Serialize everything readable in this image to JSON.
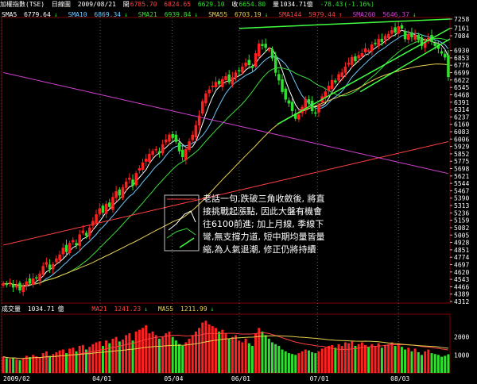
{
  "header": {
    "name": "加權指數(TSE)",
    "period": "日線圖",
    "date": "2009/08/21",
    "open_label": "開",
    "open": "6785.70",
    "high": "6824.65",
    "low": "6629.10",
    "close_label": "收",
    "close": "6654.80",
    "vol_label": "量",
    "volume": "1034.71",
    "vol_unit": "億",
    "change": "-78.43",
    "change_pct": "(-1.16%)"
  },
  "ma_legend": [
    {
      "label": "SMA5",
      "value": "6779.64",
      "arrow": "↓",
      "color": "#ffffff"
    },
    {
      "label": "SMA10",
      "value": "6869.34",
      "arrow": "↓",
      "color": "#6ec8ff"
    },
    {
      "label": "SMA21",
      "value": "6939.84",
      "arrow": "↓",
      "color": "#3cdc3c"
    },
    {
      "label": "SMA55",
      "value": "6703.19",
      "arrow": "↓",
      "color": "#e8d050"
    },
    {
      "label": "SMA144",
      "value": "5979.44",
      "arrow": "↑",
      "color": "#ff4040"
    },
    {
      "label": "SMA260",
      "value": "5646.37",
      "arrow": "↓",
      "color": "#d040d0"
    }
  ],
  "vol_legend": [
    {
      "label": "成交量",
      "value": "1034.71",
      "unit": "億",
      "color": "#ffffff"
    },
    {
      "label": "MA21",
      "value": "1241.23",
      "arrow": "↓",
      "color": "#ff4040"
    },
    {
      "label": "MA55",
      "value": "1211.99",
      "arrow": "↓",
      "color": "#e8d050"
    }
  ],
  "annotation": "老話一句,跌破三角收斂後, 將直接挑戰起漲點, 因此大盤有機會往6100前進; 加上月線, 季線下彎,無支撐力道, 短中期均量皆量縮,為人氣退潮, 修正仍將持續",
  "colors": {
    "up": "#ff2020",
    "down": "#30e030",
    "bg": "#000000",
    "axis": "#800000",
    "trend": "#40ff40"
  },
  "chart_data": [
    {
      "type": "candlestick",
      "title": "加權指數(TSE) 日線圖",
      "ylim": [
        4312,
        7258
      ],
      "y_ticks": [
        7258,
        7161,
        7084,
        6930,
        6853,
        6776,
        6699,
        6622,
        6545,
        6468,
        6391,
        6314,
        6237,
        6160,
        6083,
        6006,
        5929,
        5852,
        5775,
        5698,
        5621,
        5544,
        5467,
        5390,
        5313,
        5236,
        5159,
        5082,
        5005,
        4928,
        4851,
        4774,
        4697,
        4620,
        4543,
        4466,
        4389,
        4312
      ],
      "x_ticks": [
        "2009/02",
        "04/01",
        "05/04",
        "06/01",
        "07/01",
        "08/03"
      ],
      "close_series": [
        4500,
        4490,
        4510,
        4460,
        4480,
        4430,
        4470,
        4520,
        4500,
        4550,
        4560,
        4600,
        4680,
        4720,
        4650,
        4700,
        4760,
        4800,
        4870,
        4830,
        4920,
        4950,
        4900,
        5010,
        5050,
        5000,
        5080,
        5150,
        5220,
        5280,
        5240,
        5330,
        5300,
        5400,
        5460,
        5420,
        5500,
        5560,
        5600,
        5520,
        5650,
        5700,
        5760,
        5800,
        5850,
        5880,
        5900,
        5860,
        5950,
        6000,
        6050,
        6020,
        5980,
        5880,
        5820,
        5900,
        5980,
        6050,
        6150,
        6250,
        6400,
        6480,
        6520,
        6560,
        6600,
        6580,
        6630,
        6660,
        6600,
        6650,
        6700,
        6720,
        6760,
        6800,
        6780,
        6750,
        6900,
        7000,
        6980,
        6960,
        6940,
        6850,
        6700,
        6620,
        6500,
        6420,
        6380,
        6300,
        6220,
        6260,
        6340,
        6420,
        6380,
        6300,
        6280,
        6360,
        6450,
        6500,
        6560,
        6620,
        6600,
        6680,
        6700,
        6760,
        6800,
        6860,
        6820,
        6880,
        6900,
        6950,
        6930,
        6990,
        7000,
        7050,
        7020,
        7080,
        7100,
        7140,
        7120,
        7180,
        7160,
        7050,
        7100,
        7070,
        7090,
        7040,
        6980,
        7020,
        7060,
        7020,
        6980,
        6950,
        6900,
        6860,
        6654.8
      ],
      "trendlines": [
        {
          "from": [
            "06/01",
            7161
          ],
          "to": [
            "08/21",
            7258
          ]
        },
        {
          "from": [
            "06/15",
            6160
          ],
          "to": [
            "08/21",
            7161
          ]
        },
        {
          "from": [
            "07/15",
            6500
          ],
          "to": [
            "08/21",
            7050
          ]
        }
      ],
      "moving_averages": [
        {
          "name": "SMA5",
          "value": 6779.64
        },
        {
          "name": "SMA10",
          "value": 6869.34
        },
        {
          "name": "SMA21",
          "value": 6939.84
        },
        {
          "name": "SMA55",
          "value": 6703.19
        },
        {
          "name": "SMA144",
          "value": 5979.44
        },
        {
          "name": "SMA260",
          "value": 5646.37
        }
      ]
    },
    {
      "type": "bar",
      "title": "成交量",
      "y_ticks": [
        1000,
        2000
      ],
      "values": [
        900,
        820,
        780,
        850,
        760,
        700,
        820,
        950,
        880,
        1000,
        920,
        860,
        1100,
        1200,
        950,
        1050,
        1150,
        1250,
        1300,
        1100,
        1350,
        1400,
        1200,
        1500,
        1550,
        1300,
        1450,
        1600,
        1700,
        1750,
        1500,
        1800,
        1650,
        1900,
        2000,
        1750,
        1850,
        2100,
        2200,
        1800,
        2300,
        2400,
        2500,
        2650,
        2200,
        2300,
        2100,
        1900,
        2000,
        2200,
        2300,
        2000,
        1800,
        1600,
        1500,
        1700,
        1900,
        2100,
        2300,
        2500,
        2800,
        2900,
        2700,
        2600,
        2500,
        2300,
        2400,
        2200,
        1900,
        2000,
        2100,
        1800,
        1700,
        1900,
        1650,
        1500,
        2200,
        2500,
        2300,
        2100,
        1900,
        1700,
        1600,
        1500,
        1300,
        1200,
        1100,
        1050,
        1000,
        1100,
        1200,
        1300,
        1250,
        1150,
        1100,
        1200,
        1350,
        1400,
        1500,
        1550,
        1400,
        1600,
        1500,
        1700,
        1650,
        1750,
        1500,
        1600,
        1700,
        1550,
        1450,
        1600,
        1500,
        1650,
        1400,
        1550,
        1600,
        1700,
        1500,
        1650,
        1450,
        1300,
        1400,
        1200,
        1350,
        1150,
        1000,
        1200,
        1300,
        1100,
        1050,
        1000,
        900,
        950,
        1034.71
      ],
      "moving_averages": [
        {
          "name": "MA21",
          "value": 1241.23
        },
        {
          "name": "MA55",
          "value": 1211.99
        }
      ]
    }
  ]
}
